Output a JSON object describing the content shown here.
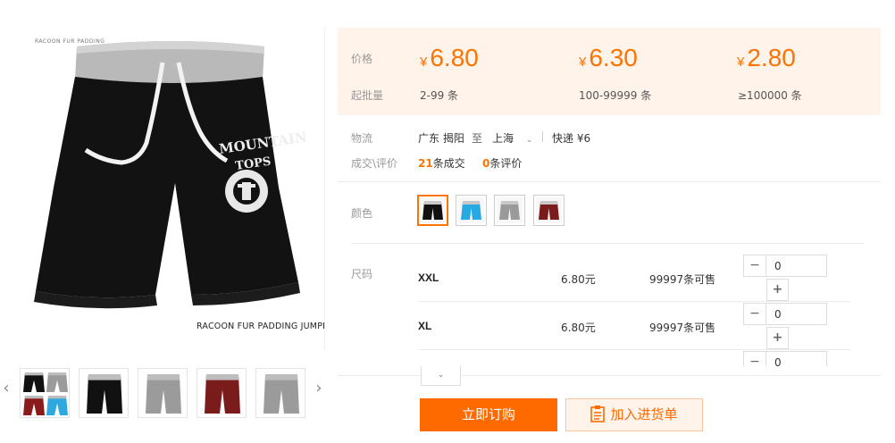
{
  "gallery": {
    "caption_top": "RACOON FUR PADDING",
    "caption_bottom": "RACOON FUR PADDING JUMPER",
    "logo_text_1": "MOUNTAIN",
    "logo_text_2": "TOPS",
    "thumbnails": [
      {
        "name": "multi-color",
        "colors": [
          "#111111",
          "#9b9b9b",
          "#8b1a1a",
          "#2fa8e0"
        ]
      },
      {
        "name": "black",
        "colors": [
          "#111111"
        ]
      },
      {
        "name": "grey",
        "colors": [
          "#9b9b9b"
        ]
      },
      {
        "name": "wine-red",
        "colors": [
          "#7a1c1c"
        ]
      },
      {
        "name": "grey-2",
        "colors": [
          "#9b9b9b"
        ]
      }
    ],
    "prev_arrow": "‹",
    "next_arrow": "›"
  },
  "pricing": {
    "price_label": "价格",
    "moq_label": "起批量",
    "currency": "¥",
    "tiers": [
      {
        "price": "6.80",
        "range": "2-99 条"
      },
      {
        "price": "6.30",
        "range": "100-99999 条"
      },
      {
        "price": "2.80",
        "range": "≥100000 条"
      }
    ]
  },
  "logistics": {
    "label": "物流",
    "from": "广东 揭阳",
    "to_word": "至",
    "to": "上海",
    "shipping": "快递 ¥6"
  },
  "trades": {
    "label": "成交\\评价",
    "deals_count": "21",
    "deals_text": "条成交",
    "reviews_count": "0",
    "reviews_text": "条评价"
  },
  "colors": {
    "label": "颜色",
    "options": [
      {
        "name": "black",
        "hex": "#111111",
        "selected": true
      },
      {
        "name": "blue",
        "hex": "#27a9e3",
        "selected": false
      },
      {
        "name": "grey",
        "hex": "#9a9a9a",
        "selected": false
      },
      {
        "name": "wine-red",
        "hex": "#7a1c1c",
        "selected": false
      }
    ]
  },
  "sizes": {
    "label": "尺码",
    "rows": [
      {
        "size": "XXL",
        "price": "6.80元",
        "stock": "99997条可售",
        "qty": "0"
      },
      {
        "size": "XL",
        "price": "6.80元",
        "stock": "99997条可售",
        "qty": "0"
      },
      {
        "qty": "0"
      }
    ],
    "minus": "−",
    "plus": "+",
    "expand_icon": "⌄"
  },
  "actions": {
    "order_button": "立即订购",
    "cart_button": "加入进货单"
  },
  "theme": {
    "accent": "#ff6a00",
    "price_bg": "#fff3ea"
  }
}
